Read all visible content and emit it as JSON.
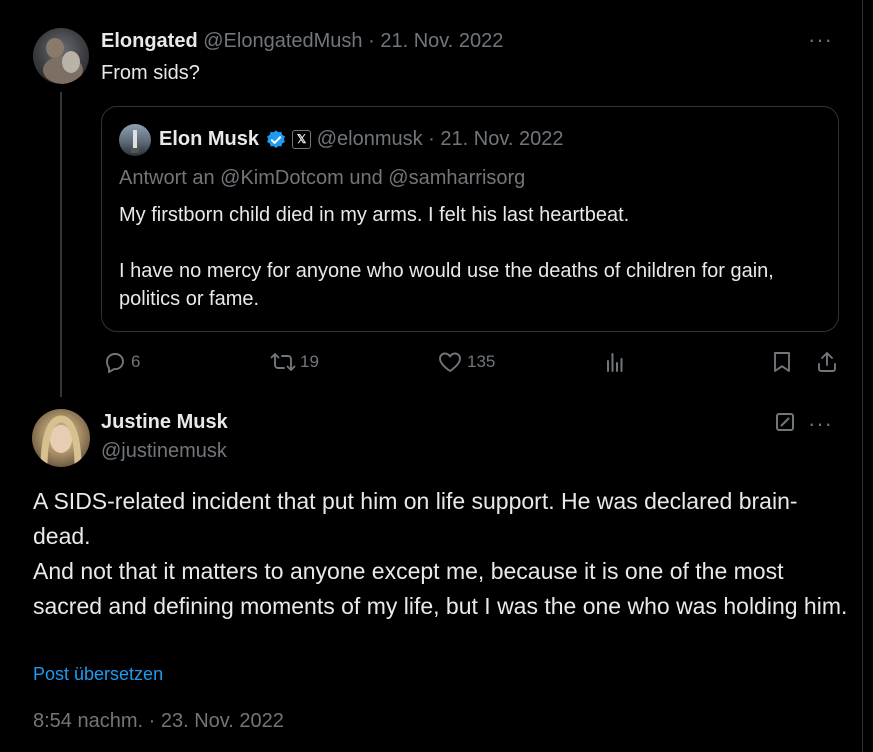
{
  "tweet1": {
    "name": "Elongated",
    "handle": "@ElongatedMush",
    "sep": "·",
    "date": "21. Nov. 2022",
    "text": "From sids?"
  },
  "quote": {
    "name": "Elon Musk",
    "affiliate_badge": "𝕏",
    "handle": "@elonmusk",
    "sep": "·",
    "date": "21. Nov. 2022",
    "reply_to": "Antwort an @KimDotcom und @samharrisorg",
    "para1": "My firstborn child died in my arms. I felt his last heartbeat.",
    "para2": "I have no mercy for anyone who would use the deaths of children for gain, politics or fame."
  },
  "actions": {
    "replies": "6",
    "reposts": "19",
    "likes": "135"
  },
  "tweet2": {
    "name": "Justine Musk",
    "handle": "@justinemusk",
    "text_line1": "A SIDS-related incident that put him on life support. He was declared brain-dead.",
    "text_line2": "And not that it matters to anyone except me, because it is one of the most sacred and defining moments of my life, but I was the one who was holding him.",
    "translate": "Post übersetzen",
    "timestamp": "8:54 nachm. · 23. Nov. 2022"
  },
  "colors": {
    "background": "#000000",
    "text": "#e7e9ea",
    "muted": "#71767b",
    "link": "#1d9bf0",
    "border": "#2f3336",
    "verified": "#1d9bf0"
  },
  "icons": [
    "more-icon",
    "verified-icon",
    "reply-icon",
    "repost-icon",
    "like-icon",
    "views-icon",
    "bookmark-icon",
    "share-icon",
    "edit-icon"
  ]
}
